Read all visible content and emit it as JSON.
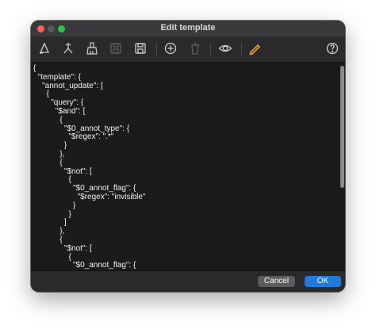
{
  "window": {
    "title": "Edit template"
  },
  "toolbar": {
    "icons": [
      {
        "name": "format-icon"
      },
      {
        "name": "merge-icon"
      },
      {
        "name": "clean-icon"
      },
      {
        "name": "save-disabled-icon"
      },
      {
        "name": "save-icon"
      },
      {
        "name": "add-icon"
      },
      {
        "name": "delete-icon"
      },
      {
        "name": "preview-icon"
      },
      {
        "name": "edit-icon"
      },
      {
        "name": "help-icon"
      }
    ],
    "accent": "#f0a030"
  },
  "editor": {
    "lines": [
      "{",
      "  \"template\": {",
      "    \"annot_update\": [",
      "      {",
      "        \"query\": {",
      "          \"$and\": [",
      "            {",
      "              \"$0_annot_type\": {",
      "                \"$regex\": \".*\"",
      "              }",
      "            },",
      "            {",
      "              \"$not\": [",
      "                {",
      "                  \"$0_annot_flag\": {",
      "                    \"$regex\": \"invisible\"",
      "                  }",
      "                }",
      "              ]",
      "            },",
      "            {",
      "              \"$not\": [",
      "                {",
      "                  \"$0_annot_flag\": {"
    ]
  },
  "footer": {
    "cancel_label": "Cancel",
    "ok_label": "OK"
  },
  "colors": {
    "ok_button": "#1f7ae0",
    "cancel_button": "#5c5c5e"
  }
}
